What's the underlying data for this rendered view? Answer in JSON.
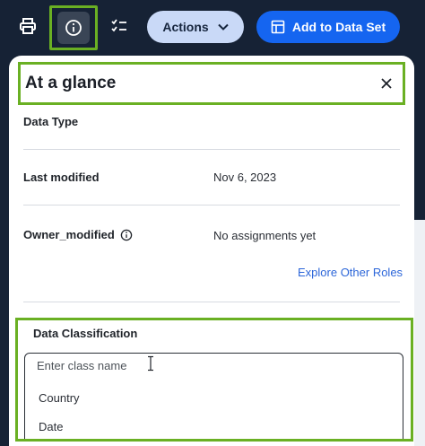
{
  "toolbar": {
    "print_icon": "printer-icon",
    "info_icon": "info-circle-icon",
    "checklist_icon": "checklist-icon",
    "actions_label": "Actions",
    "add_label": "Add to Data Set",
    "colors": {
      "dark_bg": "#162235",
      "accent": "#1565f0",
      "highlight": "#6ab023"
    }
  },
  "panel": {
    "title": "At a glance",
    "fields": {
      "data_type": {
        "label": "Data Type",
        "value": ""
      },
      "last_modified": {
        "label": "Last modified",
        "value": "Nov 6, 2023"
      },
      "owner": {
        "label": "Owner_modified",
        "value": "No assignments yet"
      }
    },
    "explore_link": "Explore Other Roles",
    "classification": {
      "label": "Data Classification",
      "placeholder": "Enter class name",
      "options": [
        "Country",
        "Date"
      ]
    }
  }
}
